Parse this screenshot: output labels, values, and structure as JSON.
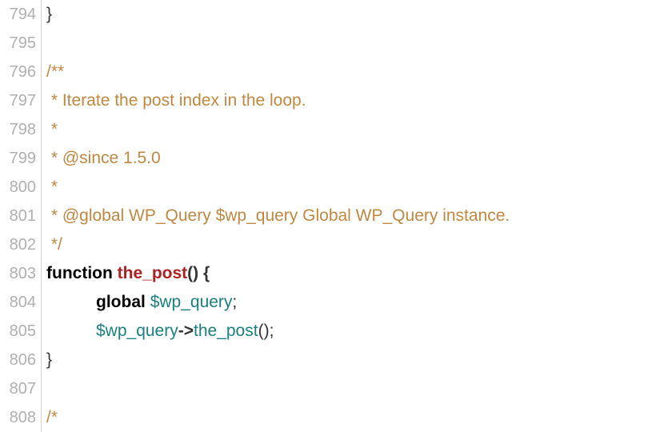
{
  "lines": [
    {
      "num": "794",
      "tokens": [
        {
          "text": "}",
          "cls": "punct"
        }
      ]
    },
    {
      "num": "795",
      "tokens": []
    },
    {
      "num": "796",
      "tokens": [
        {
          "text": "/**",
          "cls": "comment"
        }
      ]
    },
    {
      "num": "797",
      "tokens": [
        {
          "text": " * Iterate the post index in the loop.",
          "cls": "comment"
        }
      ]
    },
    {
      "num": "798",
      "tokens": [
        {
          "text": " *",
          "cls": "comment"
        }
      ]
    },
    {
      "num": "799",
      "tokens": [
        {
          "text": " * @since 1.5.0",
          "cls": "comment"
        }
      ]
    },
    {
      "num": "800",
      "tokens": [
        {
          "text": " *",
          "cls": "comment"
        }
      ]
    },
    {
      "num": "801",
      "tokens": [
        {
          "text": " * @global WP_Query $wp_query Global WP_Query instance.",
          "cls": "comment"
        }
      ]
    },
    {
      "num": "802",
      "tokens": [
        {
          "text": " */",
          "cls": "comment"
        }
      ]
    },
    {
      "num": "803",
      "tokens": [
        {
          "text": "function",
          "cls": "keyword"
        },
        {
          "text": " ",
          "cls": "punct"
        },
        {
          "text": "the_post",
          "cls": "func-name"
        },
        {
          "text": "() {",
          "cls": "bold-punct"
        }
      ]
    },
    {
      "num": "804",
      "indent": true,
      "tokens": [
        {
          "text": "global",
          "cls": "keyword"
        },
        {
          "text": " ",
          "cls": "punct"
        },
        {
          "text": "$wp_query",
          "cls": "variable"
        },
        {
          "text": ";",
          "cls": "punct"
        }
      ]
    },
    {
      "num": "805",
      "indent": true,
      "tokens": [
        {
          "text": "$wp_query",
          "cls": "variable"
        },
        {
          "text": "->",
          "cls": "bold-punct"
        },
        {
          "text": "the_post",
          "cls": "method"
        },
        {
          "text": "();",
          "cls": "punct"
        }
      ]
    },
    {
      "num": "806",
      "tokens": [
        {
          "text": "}",
          "cls": "punct"
        }
      ]
    },
    {
      "num": "807",
      "tokens": []
    },
    {
      "num": "808",
      "tokens": [
        {
          "text": "/*",
          "cls": "comment"
        }
      ]
    }
  ]
}
